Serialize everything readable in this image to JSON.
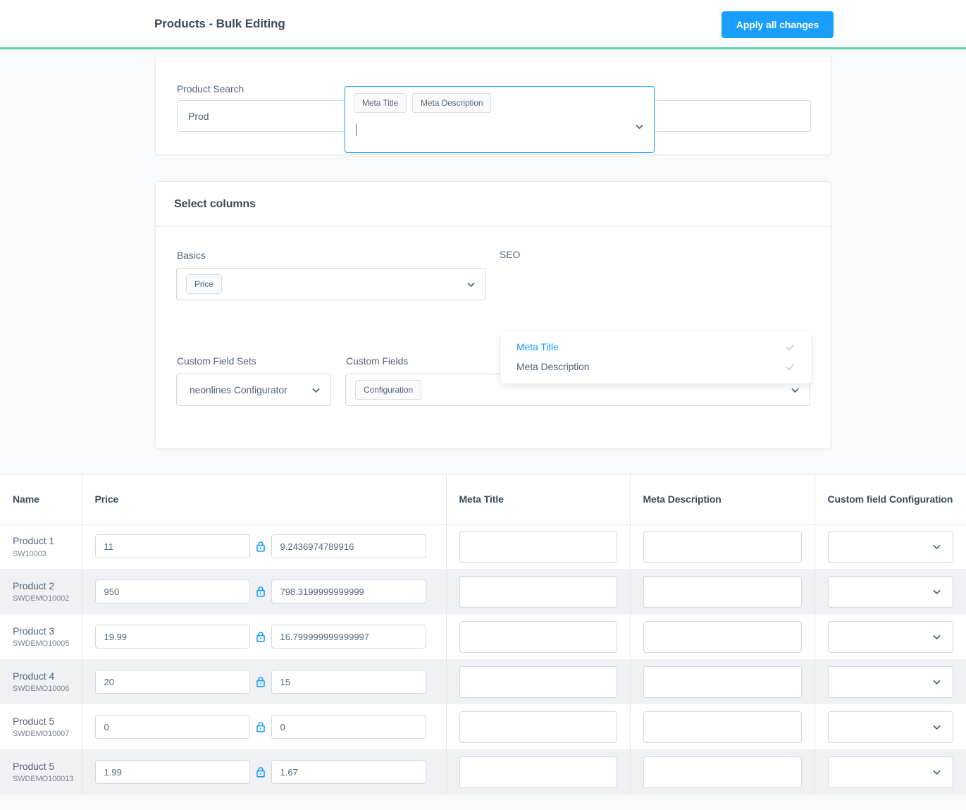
{
  "header": {
    "title": "Products - Bulk Editing",
    "apply_button": "Apply all changes",
    "accent_color": "#5DD39E",
    "button_color": "#189EFF"
  },
  "search_card": {
    "label": "Product Search",
    "value": "Prod",
    "placeholder": ""
  },
  "columns_card": {
    "title": "Select columns",
    "basics": {
      "label": "Basics",
      "chips": [
        "Price"
      ]
    },
    "seo": {
      "label": "SEO",
      "chips": [
        "Meta Title",
        "Meta Description"
      ],
      "input_value": "",
      "focused": true,
      "dropdown_options": [
        {
          "label": "Meta Title",
          "checked": true,
          "highlighted": true
        },
        {
          "label": "Meta Description",
          "checked": true,
          "highlighted": false
        }
      ]
    },
    "custom_field_sets": {
      "label": "Custom Field Sets",
      "value": "neonlines Configurator"
    },
    "custom_fields": {
      "label": "Custom Fields",
      "chips": [
        "Configuration"
      ]
    }
  },
  "table": {
    "columns": [
      "Name",
      "Price",
      "Meta Title",
      "Meta Description",
      "Custom field Configuration"
    ],
    "rows": [
      {
        "name": "Product 1",
        "number": "SW10003",
        "price_gross": "11",
        "price_net": "9.2436974789916",
        "meta_title": "",
        "meta_description": "",
        "custom_field_configuration": "",
        "locked": true,
        "striped": false
      },
      {
        "name": "Product 2",
        "number": "SWDEMO10002",
        "price_gross": "950",
        "price_net": "798.3199999999999",
        "meta_title": "",
        "meta_description": "",
        "custom_field_configuration": "",
        "locked": true,
        "striped": true
      },
      {
        "name": "Product 3",
        "number": "SWDEMO10005",
        "price_gross": "19.99",
        "price_net": "16.799999999999997",
        "meta_title": "",
        "meta_description": "",
        "custom_field_configuration": "",
        "locked": true,
        "striped": false
      },
      {
        "name": "Product 4",
        "number": "SWDEMO10006",
        "price_gross": "20",
        "price_net": "15",
        "meta_title": "",
        "meta_description": "",
        "custom_field_configuration": "",
        "locked": true,
        "striped": true
      },
      {
        "name": "Product 5",
        "number": "SWDEMO10007",
        "price_gross": "0",
        "price_net": "0",
        "meta_title": "",
        "meta_description": "",
        "custom_field_configuration": "",
        "locked": true,
        "striped": false
      },
      {
        "name": "Product 5",
        "number": "SWDEMO100013",
        "price_gross": "1.99",
        "price_net": "1.67",
        "meta_title": "",
        "meta_description": "",
        "custom_field_configuration": "",
        "locked": true,
        "striped": true
      }
    ]
  }
}
